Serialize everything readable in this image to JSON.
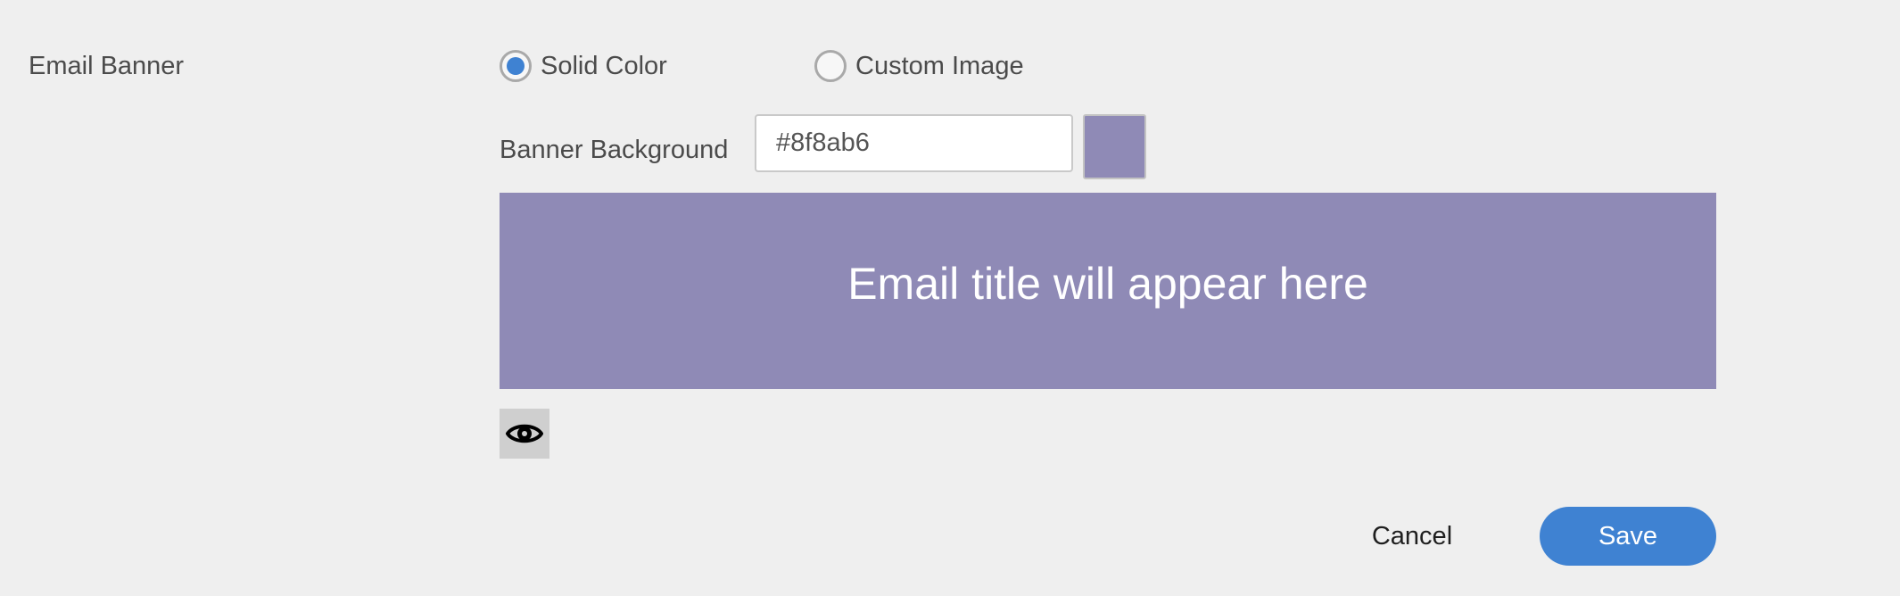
{
  "email_banner": {
    "section_label": "Email Banner",
    "options": [
      {
        "label": "Solid Color",
        "selected": true
      },
      {
        "label": "Custom Image",
        "selected": false
      }
    ],
    "background_label": "Banner Background",
    "background_value": "#8f8ab6",
    "swatch_color": "#8f8ab6",
    "preview_title": "Email title will appear here",
    "preview_icon": "eye-icon"
  },
  "actions": {
    "cancel_label": "Cancel",
    "save_label": "Save",
    "save_color": "#3f82d2"
  },
  "colors": {
    "accent": "#3f82d2",
    "page_background": "#efefef"
  }
}
